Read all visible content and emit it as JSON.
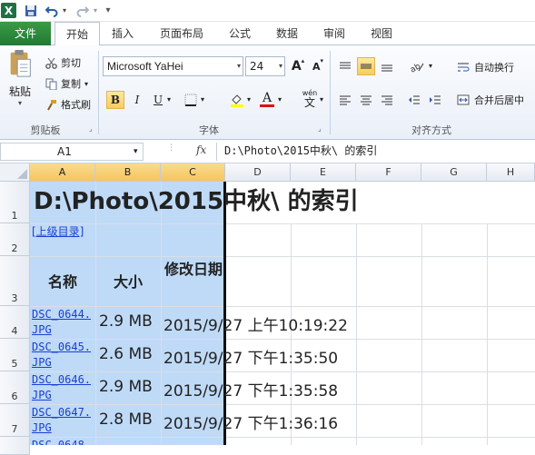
{
  "qat": {
    "logo": "X",
    "save_icon": "save-icon",
    "undo_icon": "undo-icon",
    "redo_icon": "redo-icon"
  },
  "tabs": [
    {
      "label": "文件"
    },
    {
      "label": "开始"
    },
    {
      "label": "插入"
    },
    {
      "label": "页面布局"
    },
    {
      "label": "公式"
    },
    {
      "label": "数据"
    },
    {
      "label": "审阅"
    },
    {
      "label": "视图"
    }
  ],
  "clipboard": {
    "paste": "粘贴",
    "cut": "剪切",
    "copy": "复制",
    "format_painter": "格式刷",
    "group": "剪贴板"
  },
  "font": {
    "name": "Microsoft YaHei",
    "size": "24",
    "bold": "B",
    "italic": "I",
    "underline": "U",
    "group": "字体",
    "wen": "wén",
    "wen_char": "文"
  },
  "alignment": {
    "wrap": "自动换行",
    "merge": "合并后居中",
    "group": "对齐方式"
  },
  "formula_bar": {
    "cell_ref": "A1",
    "fx": "fx",
    "content": "D:\\Photo\\2015中秋\\ 的索引"
  },
  "columns": [
    "A",
    "B",
    "C",
    "D",
    "E",
    "F",
    "G",
    "H"
  ],
  "rows": [
    "1",
    "2",
    "3",
    "4",
    "5",
    "6",
    "7"
  ],
  "sheet": {
    "title": "D:\\Photo\\2015中秋\\ 的索引",
    "parent_link": "[上级目录]",
    "headers": {
      "name": "名称",
      "size": "大小",
      "modified": "修改日期"
    },
    "files": [
      {
        "name": "DSC_0644.JPG",
        "size": "2.9 MB",
        "date": "2015/9/27 上午10:19:22"
      },
      {
        "name": "DSC_0645.JPG",
        "size": "2.6 MB",
        "date": "2015/9/27 下午1:35:50"
      },
      {
        "name": "DSC_0646.JPG",
        "size": "2.9 MB",
        "date": "2015/9/27 下午1:35:58"
      },
      {
        "name": "DSC_0647.JPG",
        "size": "2.8 MB",
        "date": "2015/9/27 下午1:36:16"
      }
    ]
  },
  "colors": {
    "accent_green": "#217a34",
    "selection": "#bfdaf7",
    "header_selected": "#f5c560",
    "link": "#1a3fd1"
  }
}
